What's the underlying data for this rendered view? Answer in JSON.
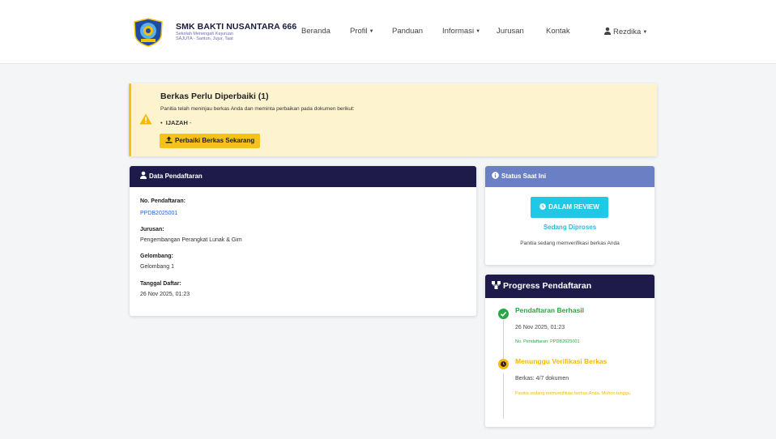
{
  "brand": {
    "name": "SMK BAKTI NUSANTARA 666",
    "subtitle": "Sekolah Menengah Kejuruan",
    "motto": "SAJUTA - Santun, Jujur, Taat"
  },
  "nav": {
    "items": [
      "Beranda",
      "Profil",
      "Panduan",
      "Informasi",
      "Jurusan",
      "Kontak"
    ],
    "user": "Rezdika"
  },
  "alert": {
    "title": "Berkas Perlu Diperbaiki (1)",
    "message": "Panitia telah meninjau berkas Anda dan meminta perbaikan pada dokumen berikut:",
    "doc_name": "IJAZAH",
    "doc_suffix": " -",
    "button": "Perbaiki Berkas Sekarang"
  },
  "registration": {
    "header": "Data Pendaftaran",
    "fields": [
      {
        "label": "No. Pendaftaran:",
        "value": "PPDB2025001"
      },
      {
        "label": "Jurusan:",
        "value": "Pengembangan Perangkat Lunak & Gim"
      },
      {
        "label": "Gelombang:",
        "value": "Gelombang 1"
      },
      {
        "label": "Tanggal Daftar:",
        "value": "26 Nov 2025, 01:23"
      }
    ]
  },
  "status": {
    "header": "Status Saat Ini",
    "badge": "DALAM REVIEW",
    "state": "Sedang Diproses",
    "message": "Panitia sedang memverifikasi berkas Anda"
  },
  "progress": {
    "header": "Progress Pendaftaran",
    "steps": [
      {
        "title": "Pendaftaran Berhasil",
        "date": "26 Nov 2025, 01:23",
        "note": "No. Pendaftaran: PPDB2025001",
        "color": "#28a745"
      },
      {
        "title": "Menunggu Verifikasi Berkas",
        "date": "Berkas: 4/7 dokumen",
        "note": "Panitia sedang memverifikasi berkas Anda. Mohon tunggu.",
        "color": "#f5b800"
      }
    ]
  },
  "colors": {
    "navy": "#1e1b4b",
    "status_header": "#6b7fc4",
    "review": "#1ec8e6",
    "warning": "#f6c21a",
    "success": "#28a745"
  }
}
